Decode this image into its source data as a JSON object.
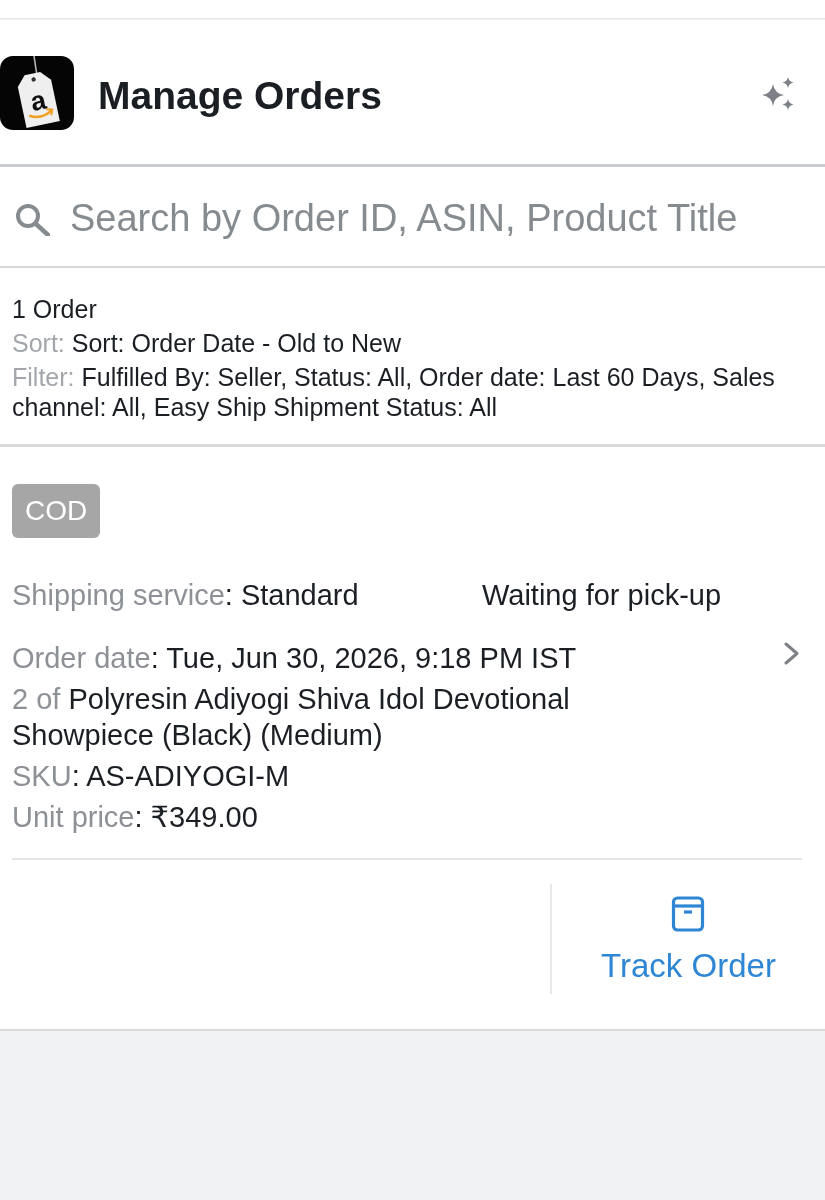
{
  "header": {
    "logo_text": "a",
    "title": "Manage Orders"
  },
  "search": {
    "placeholder": "Search by Order ID, ASIN, Product Title"
  },
  "summary": {
    "count": "1 Order",
    "sort": {
      "label": "Sort:",
      "value": "Sort: Order Date - Old to New"
    },
    "filter": {
      "label": "Filter:",
      "value": "Fulfilled By: Seller, Status: All, Order date: Last 60 Days, Sales channel: All, Easy Ship Shipment Status: All"
    }
  },
  "orders": [
    {
      "payment_badge": "COD",
      "shipping_service": {
        "label": "Shipping service",
        "value": ": Standard"
      },
      "status": "Waiting for pick-up",
      "order_date": {
        "label": "Order date",
        "value": ": Tue, Jun 30, 2026, 9:18 PM IST"
      },
      "item": {
        "quantity": "2 of",
        "title": "Polyresin Adiyogi Shiva Idol Devotional Showpiece (Black) (Medium)"
      },
      "sku": {
        "label": "SKU",
        "value": ": AS-ADIYOGI-M"
      },
      "unit_price": {
        "label": "Unit price",
        "value": ": ₹349.00"
      },
      "track_button": {
        "label": "Track Order"
      }
    }
  ]
}
